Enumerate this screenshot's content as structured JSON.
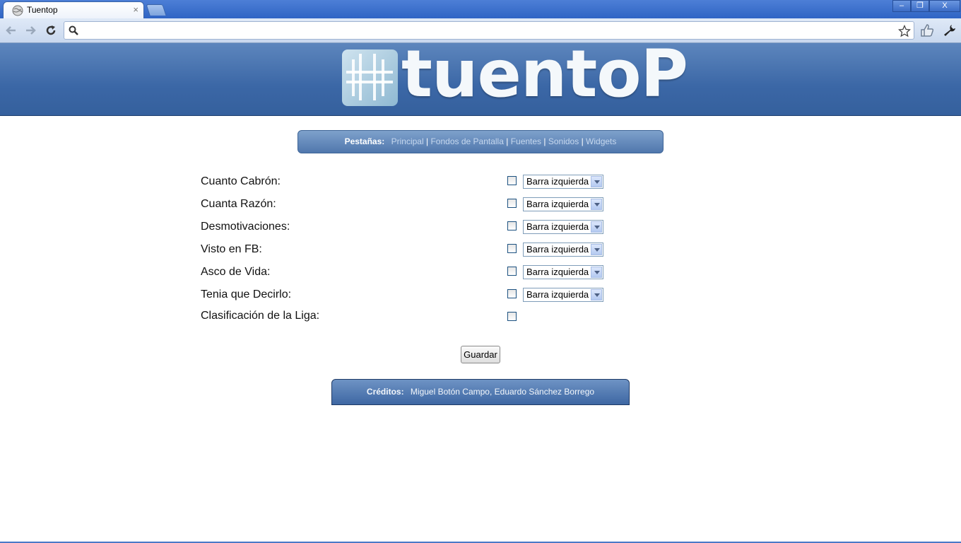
{
  "browser": {
    "tab_title": "Tuentop",
    "tab_close": "×",
    "address_value": "",
    "window_buttons": {
      "minimize": "–",
      "restore": "❐",
      "close": "X"
    }
  },
  "header": {
    "logo_text": "tuentoP"
  },
  "tabs_nav": {
    "label": "Pestañas:",
    "links": [
      "Principal",
      "Fondos de Pantalla",
      "Fuentes",
      "Sonidos",
      "Widgets"
    ],
    "separator": "|"
  },
  "settings": {
    "rows": [
      {
        "label": "Cuanto Cabrón:",
        "checked": false,
        "position": "Barra izquierda"
      },
      {
        "label": "Cuanta Razón:",
        "checked": false,
        "position": "Barra izquierda"
      },
      {
        "label": "Desmotivaciones:",
        "checked": false,
        "position": "Barra izquierda"
      },
      {
        "label": "Visto en FB:",
        "checked": false,
        "position": "Barra izquierda"
      },
      {
        "label": "Asco de Vida:",
        "checked": false,
        "position": "Barra izquierda"
      },
      {
        "label": "Tenia que Decirlo:",
        "checked": false,
        "position": "Barra izquierda"
      },
      {
        "label": "Clasificación de la Liga:",
        "checked": false
      }
    ]
  },
  "save_label": "Guardar",
  "credits": {
    "label": "Créditos:",
    "names": "Miguel Botón Campo, Eduardo Sánchez Borrego"
  },
  "colors": {
    "banner": "#3b67a6",
    "nav_bar": "#5077ad",
    "link": "#c5d7ee"
  }
}
